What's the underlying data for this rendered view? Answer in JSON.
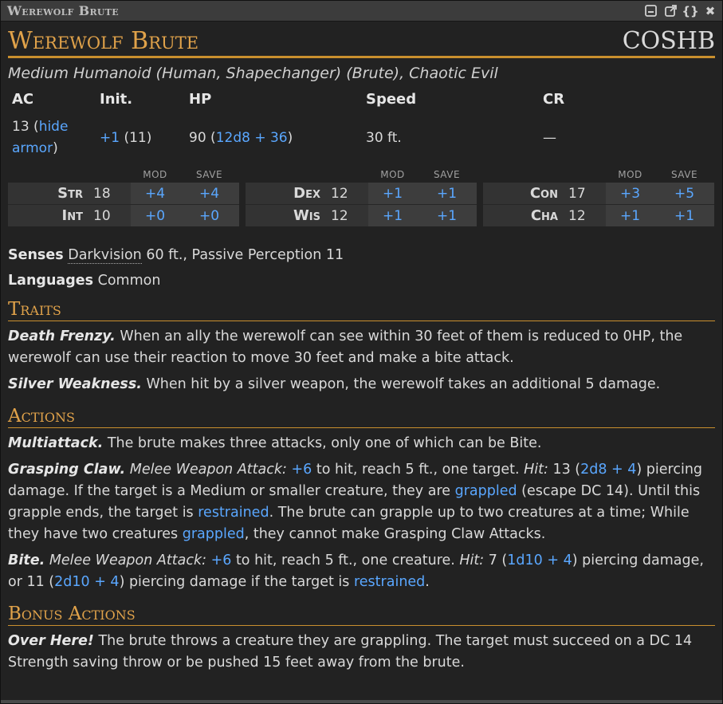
{
  "window": {
    "title": "Werewolf Brute"
  },
  "header": {
    "name": "Werewolf Brute",
    "source": "COSHB"
  },
  "subtitle": "Medium Humanoid (Human, Shapechanger) (Brute), Chaotic Evil",
  "stats": {
    "ac_label": "AC",
    "ac_value": "13",
    "ac_armor": "hide armor",
    "init_label": "Init.",
    "init_mod": "+1",
    "init_score": "(11)",
    "hp_label": "HP",
    "hp_value": "90",
    "hp_formula": "12d8 + 36",
    "speed_label": "Speed",
    "speed_value": "30 ft.",
    "cr_label": "CR",
    "cr_value": "—"
  },
  "abilities": {
    "mod_label": "MOD",
    "save_label": "SAVE",
    "str": {
      "name": "Str",
      "score": "18",
      "mod": "+4",
      "save": "+4"
    },
    "int": {
      "name": "Int",
      "score": "10",
      "mod": "+0",
      "save": "+0"
    },
    "dex": {
      "name": "Dex",
      "score": "12",
      "mod": "+1",
      "save": "+1"
    },
    "wis": {
      "name": "Wis",
      "score": "12",
      "mod": "+1",
      "save": "+1"
    },
    "con": {
      "name": "Con",
      "score": "17",
      "mod": "+3",
      "save": "+5"
    },
    "cha": {
      "name": "Cha",
      "score": "12",
      "mod": "+1",
      "save": "+1"
    }
  },
  "senses": {
    "label": "Senses",
    "darkvision": "Darkvision",
    "rest": " 60 ft., Passive Perception 11"
  },
  "languages": {
    "label": "Languages",
    "value": " Common"
  },
  "traits": {
    "heading": "Traits",
    "death_frenzy": {
      "name": "Death Frenzy.",
      "text": " When an ally the werewolf can see within 30 feet of them is reduced to 0HP, the werewolf can use their reaction to move 30 feet and make a bite attack."
    },
    "silver_weakness": {
      "name": "Silver Weakness.",
      "text": " When hit by a silver weapon, the werewolf takes an additional 5 damage."
    }
  },
  "actions": {
    "heading": "Actions",
    "multiattack": {
      "name": "Multiattack.",
      "text": " The brute makes three attacks, only one of which can be Bite."
    },
    "claw": {
      "name": "Grasping Claw.",
      "attack_type": "Melee Weapon Attack:",
      "to_hit": "+6",
      "t1": " to hit, reach 5 ft., one target. ",
      "hit_label": "Hit:",
      "dmg": " 13 (",
      "dice": "2d8 + 4",
      "t2": ") piercing damage. If the target is a Medium or smaller creature, they are ",
      "grappled1": "grappled",
      "t3": " (escape DC 14). Until this grapple ends, the target is ",
      "restrained": "restrained",
      "t4": ". The brute can grapple up to two creatures at a time; While they have two creatures ",
      "grappled2": "grappled",
      "t5": ", they cannot make Grasping Claw Attacks."
    },
    "bite": {
      "name": "Bite.",
      "attack_type": "Melee Weapon Attack:",
      "to_hit": "+6",
      "t1": " to hit, reach 5 ft., one creature. ",
      "hit_label": "Hit:",
      "dmg": " 7 (",
      "dice1": "1d10 + 4",
      "t2": ") piercing damage, or 11 (",
      "dice2": "2d10 + 4",
      "t3": ") piercing damage if the target is ",
      "restrained": "restrained",
      "t4": "."
    }
  },
  "bonus_actions": {
    "heading": "Bonus Actions",
    "over_here": {
      "name": "Over Here!",
      "text": " The brute throws a creature they are grappling. The target must succeed on a DC 14 Strength saving throw or be pushed 15 feet away from the brute."
    }
  }
}
